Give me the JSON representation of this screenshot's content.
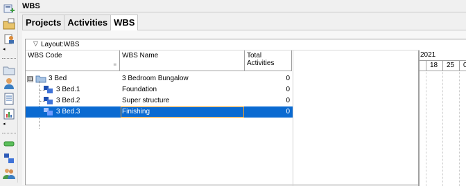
{
  "panel": {
    "title": "WBS"
  },
  "tabs": [
    {
      "label": "Projects"
    },
    {
      "label": "Activities"
    },
    {
      "label": "WBS"
    }
  ],
  "layout": {
    "label": "Layout:WBS"
  },
  "columns": [
    {
      "label": "WBS Code"
    },
    {
      "label": "WBS Name"
    },
    {
      "label": "Total Activities"
    }
  ],
  "rows": [
    {
      "code": "3 Bed",
      "name": "3 Bedroom Bungalow",
      "total": "0",
      "expander": "⊟"
    },
    {
      "code": "3 Bed.1",
      "name": "Foundation",
      "total": "0"
    },
    {
      "code": "3 Bed.2",
      "name": "Super structure",
      "total": "0"
    },
    {
      "code": "3 Bed.3",
      "name": "Finishing",
      "total": "0"
    }
  ],
  "gantt": {
    "year": "2021",
    "weeks": [
      "18",
      "25",
      "0"
    ]
  },
  "icons": {
    "toolbar": [
      "add-project-icon",
      "open-folder-icon",
      "user-edit-icon",
      "folder-icon",
      "person-icon",
      "document-icon",
      "chart-icon",
      "green-bar-icon",
      "wbs-icon",
      "people-icon"
    ]
  }
}
